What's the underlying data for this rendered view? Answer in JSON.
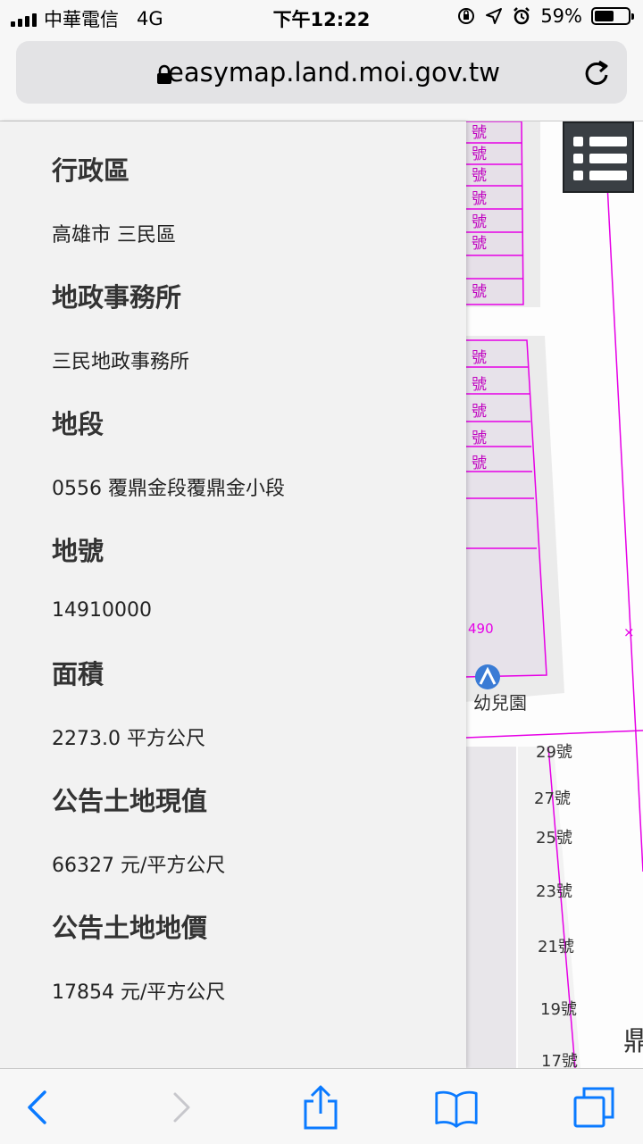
{
  "status_bar": {
    "carrier": "中華電信",
    "network": "4G",
    "time": "下午12:22",
    "battery_percent": "59%",
    "battery_level": 0.59,
    "icons": [
      "signal-icon",
      "orientation-lock-icon",
      "location-icon",
      "alarm-icon",
      "battery-icon"
    ]
  },
  "browser": {
    "url": "easymap.land.moi.gov.tw",
    "icons": [
      "lock-icon",
      "reload-icon"
    ]
  },
  "map": {
    "map_label": "490",
    "place_label": "幼兒園",
    "partial_labels": [
      "號",
      "號",
      "號",
      "號",
      "號",
      "號",
      "號",
      "號",
      "號",
      "號",
      "號",
      "號"
    ],
    "street_numbers": [
      "29號",
      "27號",
      "25號",
      "23號",
      "21號",
      "19號",
      "17號"
    ],
    "edge_label": "鼎",
    "parcel_color": "#e600e6",
    "menu_icon": "list-icon"
  },
  "panel": {
    "fields": [
      {
        "label": "行政區",
        "value": "高雄市 三民區"
      },
      {
        "label": "地政事務所",
        "value": "三民地政事務所"
      },
      {
        "label": "地段",
        "value": "0556 覆鼎金段覆鼎金小段"
      },
      {
        "label": "地號",
        "value": "14910000"
      },
      {
        "label": "面積",
        "value": "2273.0 平方公尺"
      },
      {
        "label": "公告土地現值",
        "value": "66327 元/平方公尺"
      },
      {
        "label": "公告土地地價",
        "value": "17854 元/平方公尺"
      }
    ]
  },
  "toolbar": {
    "icons": [
      "back-icon",
      "forward-icon",
      "share-icon",
      "bookmarks-icon",
      "tabs-icon"
    ],
    "accent": "#0a7aff"
  }
}
